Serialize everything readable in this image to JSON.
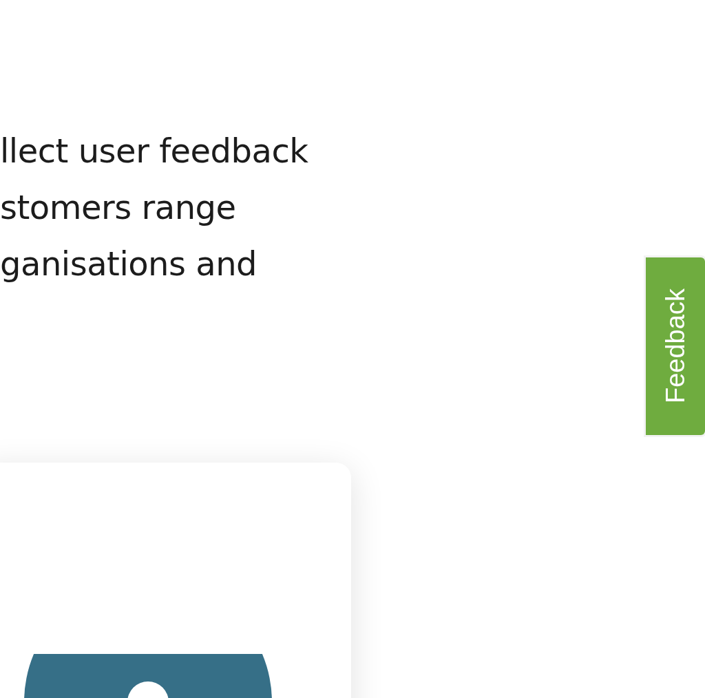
{
  "intro_lines": [
    "llect user feedback",
    "stomers range",
    "ganisations and"
  ],
  "feedback_tab": {
    "label": "Feedback"
  }
}
